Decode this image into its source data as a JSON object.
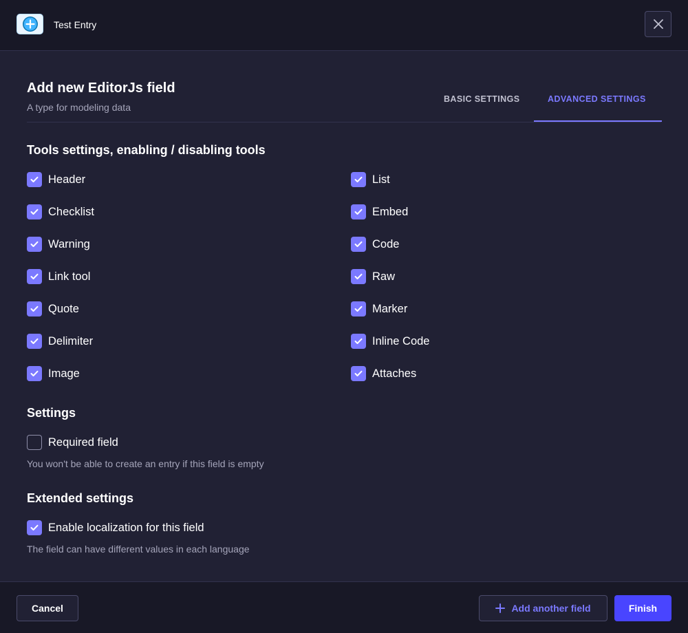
{
  "app": {
    "title": "Test Entry",
    "icon": "plus-circle-icon"
  },
  "modal": {
    "title": "Add new EditorJs field",
    "subtitle": "A type for modeling data",
    "tabs": [
      {
        "label": "BASIC SETTINGS",
        "active": false
      },
      {
        "label": "ADVANCED SETTINGS",
        "active": true
      }
    ]
  },
  "tools": {
    "heading": "Tools settings, enabling / disabling tools",
    "left": [
      {
        "label": "Header",
        "checked": true
      },
      {
        "label": "Checklist",
        "checked": true
      },
      {
        "label": "Warning",
        "checked": true
      },
      {
        "label": "Link tool",
        "checked": true
      },
      {
        "label": "Quote",
        "checked": true
      },
      {
        "label": "Delimiter",
        "checked": true
      },
      {
        "label": "Image",
        "checked": true
      }
    ],
    "right": [
      {
        "label": "List",
        "checked": true
      },
      {
        "label": "Embed",
        "checked": true
      },
      {
        "label": "Code",
        "checked": true
      },
      {
        "label": "Raw",
        "checked": true
      },
      {
        "label": "Marker",
        "checked": true
      },
      {
        "label": "Inline Code",
        "checked": true
      },
      {
        "label": "Attaches",
        "checked": true
      }
    ]
  },
  "settings": {
    "heading": "Settings",
    "required": {
      "label": "Required field",
      "checked": false
    },
    "required_hint": "You won't be able to create an entry if this field is empty"
  },
  "extended": {
    "heading": "Extended settings",
    "localization": {
      "label": "Enable localization for this field",
      "checked": true
    },
    "localization_hint": "The field can have different values in each language"
  },
  "footer": {
    "cancel_label": "Cancel",
    "add_label": "Add another field",
    "finish_label": "Finish"
  },
  "colors": {
    "accent": "#7b79ff",
    "primary_button": "#4945ff",
    "background": "#212134",
    "bar_background": "#181826"
  }
}
